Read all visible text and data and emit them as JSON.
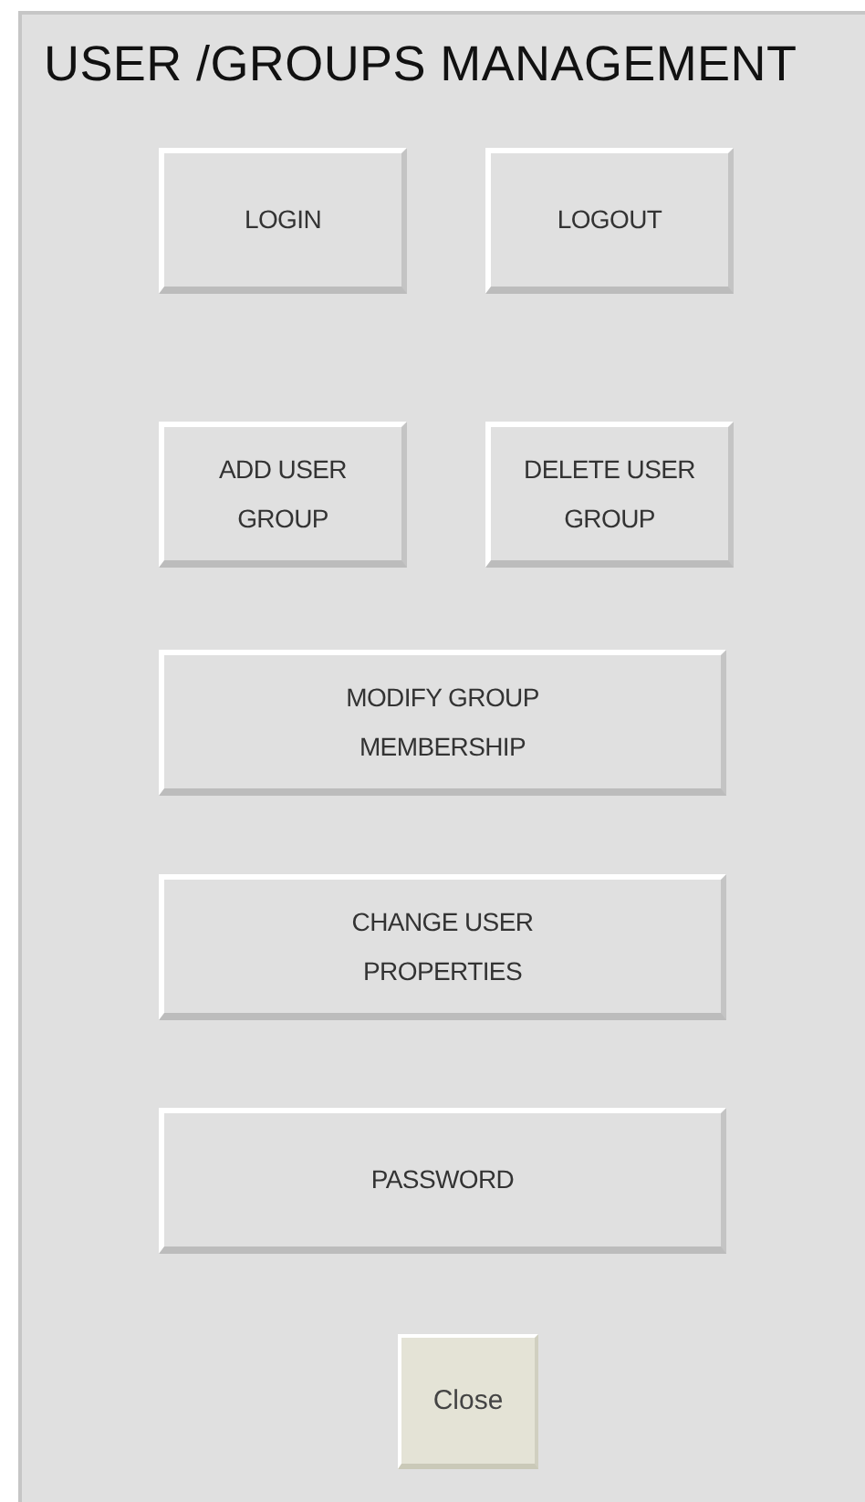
{
  "title": "USER /GROUPS MANAGEMENT",
  "rows": [
    [
      {
        "label": "LOGIN",
        "kind": "small"
      },
      {
        "label": "LOGOUT",
        "kind": "small"
      }
    ],
    [
      {
        "label": "ADD USER GROUP",
        "kind": "small"
      },
      {
        "label": "DELETE USER GROUP",
        "kind": "small"
      }
    ],
    [
      {
        "label": "MODIFY GROUP MEMBERSHIP",
        "kind": "wide"
      }
    ],
    [
      {
        "label": "CHANGE USER PROPERTIES",
        "kind": "wide"
      }
    ],
    [
      {
        "label": "PASSWORD",
        "kind": "wide"
      }
    ]
  ],
  "close_button": {
    "label": "Close"
  }
}
